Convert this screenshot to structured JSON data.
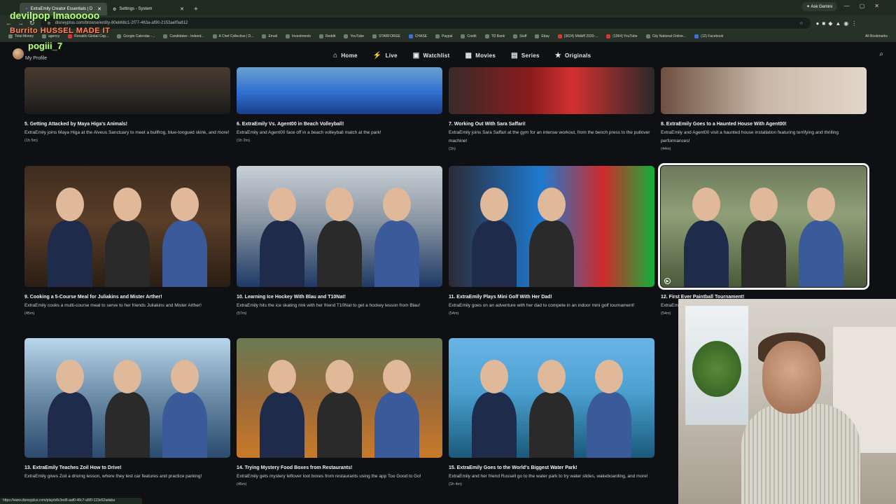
{
  "browser": {
    "tabs": [
      {
        "label": "ExtraEmily Creator Essentials | D"
      },
      {
        "label": "Settings - System"
      }
    ],
    "new_tab": "+",
    "ask_gemini": "Ask Gemini",
    "url": "disneyplus.com/browse/entity-80eb68c1-2f77-463a-af90-2153aef0a812",
    "bookmarks": [
      "Total Money",
      "agency",
      "Renaldo Global Cap...",
      "Google Calendar -...",
      "Candidates - Indeed...",
      "A Chef Collective | D...",
      "Email",
      "Investments",
      "Reddit",
      "YouTube",
      "STARFORGE",
      "CHASE",
      "Paypal",
      "Credit",
      "TD Bank",
      "Stuff",
      "Ebay",
      "(3624) Midkiff 2020-...",
      "(1964) YouTube",
      "City National Online...",
      "(12) Facebook"
    ],
    "all_bookmarks": "All Bookmarks",
    "status_url": "https://www.disneyplus.com/play/e8c3ed6-aaf0-40c7-a5f0-123e52adaba"
  },
  "overlay": {
    "name1": "devilpop lmaooooo",
    "name2": "Burrito HUSSEL MADE IT",
    "name3": "pogiii_7"
  },
  "header": {
    "profile_label": "My Profile",
    "nav": [
      {
        "icon": "house-icon",
        "glyph": "⌂",
        "label": "Home"
      },
      {
        "icon": "lightning-icon",
        "glyph": "⚡",
        "label": "Live"
      },
      {
        "icon": "watchlist-icon",
        "glyph": "▣",
        "label": "Watchlist"
      },
      {
        "icon": "movie-icon",
        "glyph": "▦",
        "label": "Movies"
      },
      {
        "icon": "tv-icon",
        "glyph": "▤",
        "label": "Series"
      },
      {
        "icon": "star-icon",
        "glyph": "★",
        "label": "Originals"
      }
    ],
    "search_glyph": "⌕"
  },
  "episodes": [
    {
      "title": "5. Getting Attacked by Maya Higa's Animals!",
      "desc": "ExtraEmily joins Maya Higa at the Alveus Sanctuary to meet a bullfrog, blue-tongued skink, and more!",
      "duration": "(1h 5m)"
    },
    {
      "title": "6. ExtraEmily Vs. Agent00 in Beach Volleyball!",
      "desc": "ExtraEmily and Agent00 face off in a beach volleyball match at the park!",
      "duration": "(1h 2m)"
    },
    {
      "title": "7. Working Out With Sara Saffari!",
      "desc": "ExtraEmily joins Sara Saffari at the gym for an intense workout, from the bench press to the pullover machine!",
      "duration": "(1h)"
    },
    {
      "title": "8. ExtraEmily Goes to a Haunted House With Agent00!",
      "desc": "ExtraEmily and Agent00 visit a haunted house installation featuring terrifying and thrilling performances!",
      "duration": "(44m)"
    },
    {
      "title": "9. Cooking a 5-Course Meal for Juliakins and Mister Arther!",
      "desc": "ExtraEmily cooks a multi-course meal to serve to her friends Juliakins and Mister Arther!",
      "duration": "(45m)"
    },
    {
      "title": "10. Learning Ice Hockey With Blau and T10Nat!",
      "desc": "ExtraEmily hits the ice skating rink with her friend T10Nat to get a hockey lesson from Blau!",
      "duration": "(57m)"
    },
    {
      "title": "11. ExtraEmily Plays Mini Golf With Her Dad!",
      "desc": "ExtraEmily goes on an adventure with her dad to compete in an indoor mini golf tournament!",
      "duration": "(54m)"
    },
    {
      "title": "12. First Ever Paintball Tournament!",
      "desc": "ExtraEmily outdoo",
      "duration": "(54m)"
    },
    {
      "title": "13. ExtraEmily Teaches Zoil How to Drive!",
      "desc": "ExtraEmily gives Zoil a driving lesson, where they test car features and practice parking!",
      "duration": ""
    },
    {
      "title": "14. Trying Mystery Food Boxes from Restaurants!",
      "desc": "ExtraEmily gets mystery leftover loot boxes from restaurants using the app Too Good to Go!",
      "duration": "(45m)"
    },
    {
      "title": "15. ExtraEmily Goes to the World's Biggest Water Park!",
      "desc": "ExtraEmily and her friend Russell go to the water park to try water slides, wakeboarding, and more!",
      "duration": "(1h 4m)"
    }
  ]
}
